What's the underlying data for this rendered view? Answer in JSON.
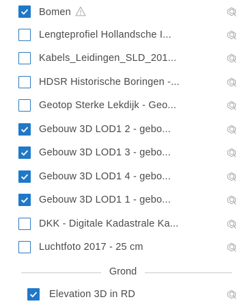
{
  "layers": [
    {
      "label": "Bomen",
      "checked": true,
      "warning": true
    },
    {
      "label": "Lengteprofiel Hollandsche I...",
      "checked": false
    },
    {
      "label": "Kabels_Leidingen_SLD_201...",
      "checked": false
    },
    {
      "label": "HDSR Historische Boringen -...",
      "checked": false
    },
    {
      "label": "Geotop Sterke Lekdijk - Geo...",
      "checked": false
    },
    {
      "label": "Gebouw 3D LOD1 2 - gebo...",
      "checked": true
    },
    {
      "label": "Gebouw 3D LOD1 3 - gebo...",
      "checked": true
    },
    {
      "label": "Gebouw 3D LOD1 4 - gebo...",
      "checked": true
    },
    {
      "label": "Gebouw 3D LOD1 1 - gebo...",
      "checked": true
    },
    {
      "label": "DKK - Digitale Kadastrale Ka...",
      "checked": false
    },
    {
      "label": "Luchtfoto 2017 - 25 cm",
      "checked": false
    }
  ],
  "group": {
    "label": "Grond",
    "layers": [
      {
        "label": "Elevation 3D in RD",
        "checked": true
      }
    ]
  },
  "colors": {
    "checkbox_fill": "#1f78c8",
    "checkbox_border": "#2e7bbf",
    "text": "#4a4a4a",
    "icon": "#a8a8a8",
    "divider": "#c9c9c9"
  },
  "icons": {
    "warning": "warning-triangle-icon",
    "zoom": "zoom-to-layer-icon"
  }
}
